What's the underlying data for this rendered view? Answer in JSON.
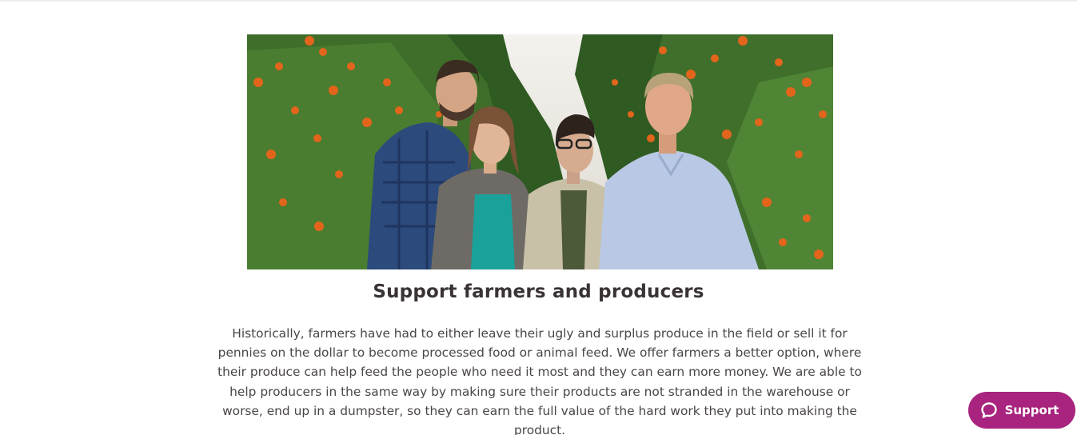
{
  "hero": {
    "image_alt": "Four smiling people standing in an orange grove",
    "icon": "photo"
  },
  "content": {
    "title": "Support farmers and producers",
    "paragraph": "Historically, farmers have had to either leave their ugly and surplus produce in the field or sell it for pennies on the dollar to become processed food or animal feed. We offer farmers a better option, where their produce can help feed the people who need it most and they can earn more money.  We are able to help producers in the same way by making sure their products are not stranded in the warehouse or worse, end up in a dumpster, so they can earn the full value of the hard work they put into making the product."
  },
  "support_widget": {
    "label": "Support",
    "icon": "chat-bubble-icon",
    "color": "#a8247e"
  }
}
